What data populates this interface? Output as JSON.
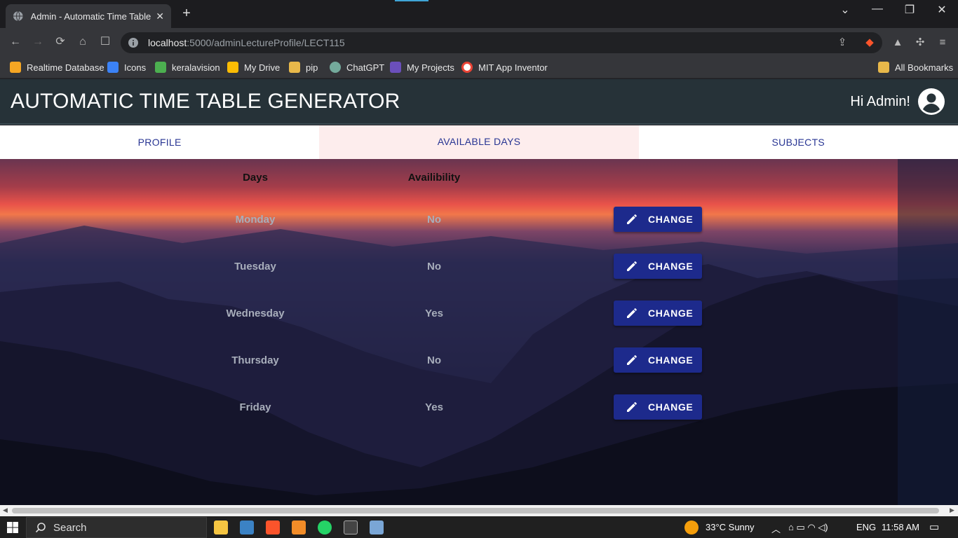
{
  "browser": {
    "tab_title": "Admin - Automatic Time Table G",
    "new_tab": "+",
    "url_host": "localhost",
    "url_path": ":5000/adminLectureProfile/LECT115",
    "bookmarks": [
      {
        "label": "Realtime Database",
        "color": "#f6a623"
      },
      {
        "label": "Icons",
        "color": "#3b82f6"
      },
      {
        "label": "keralavision",
        "color": "#4caf50"
      },
      {
        "label": "My Drive",
        "color": "#fbbc04"
      },
      {
        "label": "pip",
        "color": "#e8b84a"
      },
      {
        "label": "ChatGPT",
        "color": "#74aa9c"
      },
      {
        "label": "My Projects",
        "color": "#6b4fbb"
      },
      {
        "label": "MIT App Inventor",
        "color": "#ea4335"
      }
    ],
    "all_bookmarks": "All Bookmarks"
  },
  "app": {
    "title": "AUTOMATIC TIME TABLE GENERATOR",
    "greeting": "Hi Admin!"
  },
  "tabs": [
    {
      "label": "PROFILE",
      "active": false
    },
    {
      "label": "AVAILABLE DAYS",
      "active": true
    },
    {
      "label": "SUBJECTS",
      "active": false
    }
  ],
  "table": {
    "headers": {
      "days": "Days",
      "availability": "Availibility"
    },
    "rows": [
      {
        "day": "Monday",
        "available": "No",
        "action": "CHANGE"
      },
      {
        "day": "Tuesday",
        "available": "No",
        "action": "CHANGE"
      },
      {
        "day": "Wednesday",
        "available": "Yes",
        "action": "CHANGE"
      },
      {
        "day": "Thursday",
        "available": "No",
        "action": "CHANGE"
      },
      {
        "day": "Friday",
        "available": "Yes",
        "action": "CHANGE"
      }
    ]
  },
  "taskbar": {
    "search_label": "Search",
    "weather": "33°C  Sunny",
    "language": "ENG",
    "time": "11:58 AM"
  },
  "colors": {
    "header_bg": "#263238",
    "tab_text": "#283593",
    "active_tab_bg": "#fdeded",
    "button_bg": "#1d2a8c"
  }
}
